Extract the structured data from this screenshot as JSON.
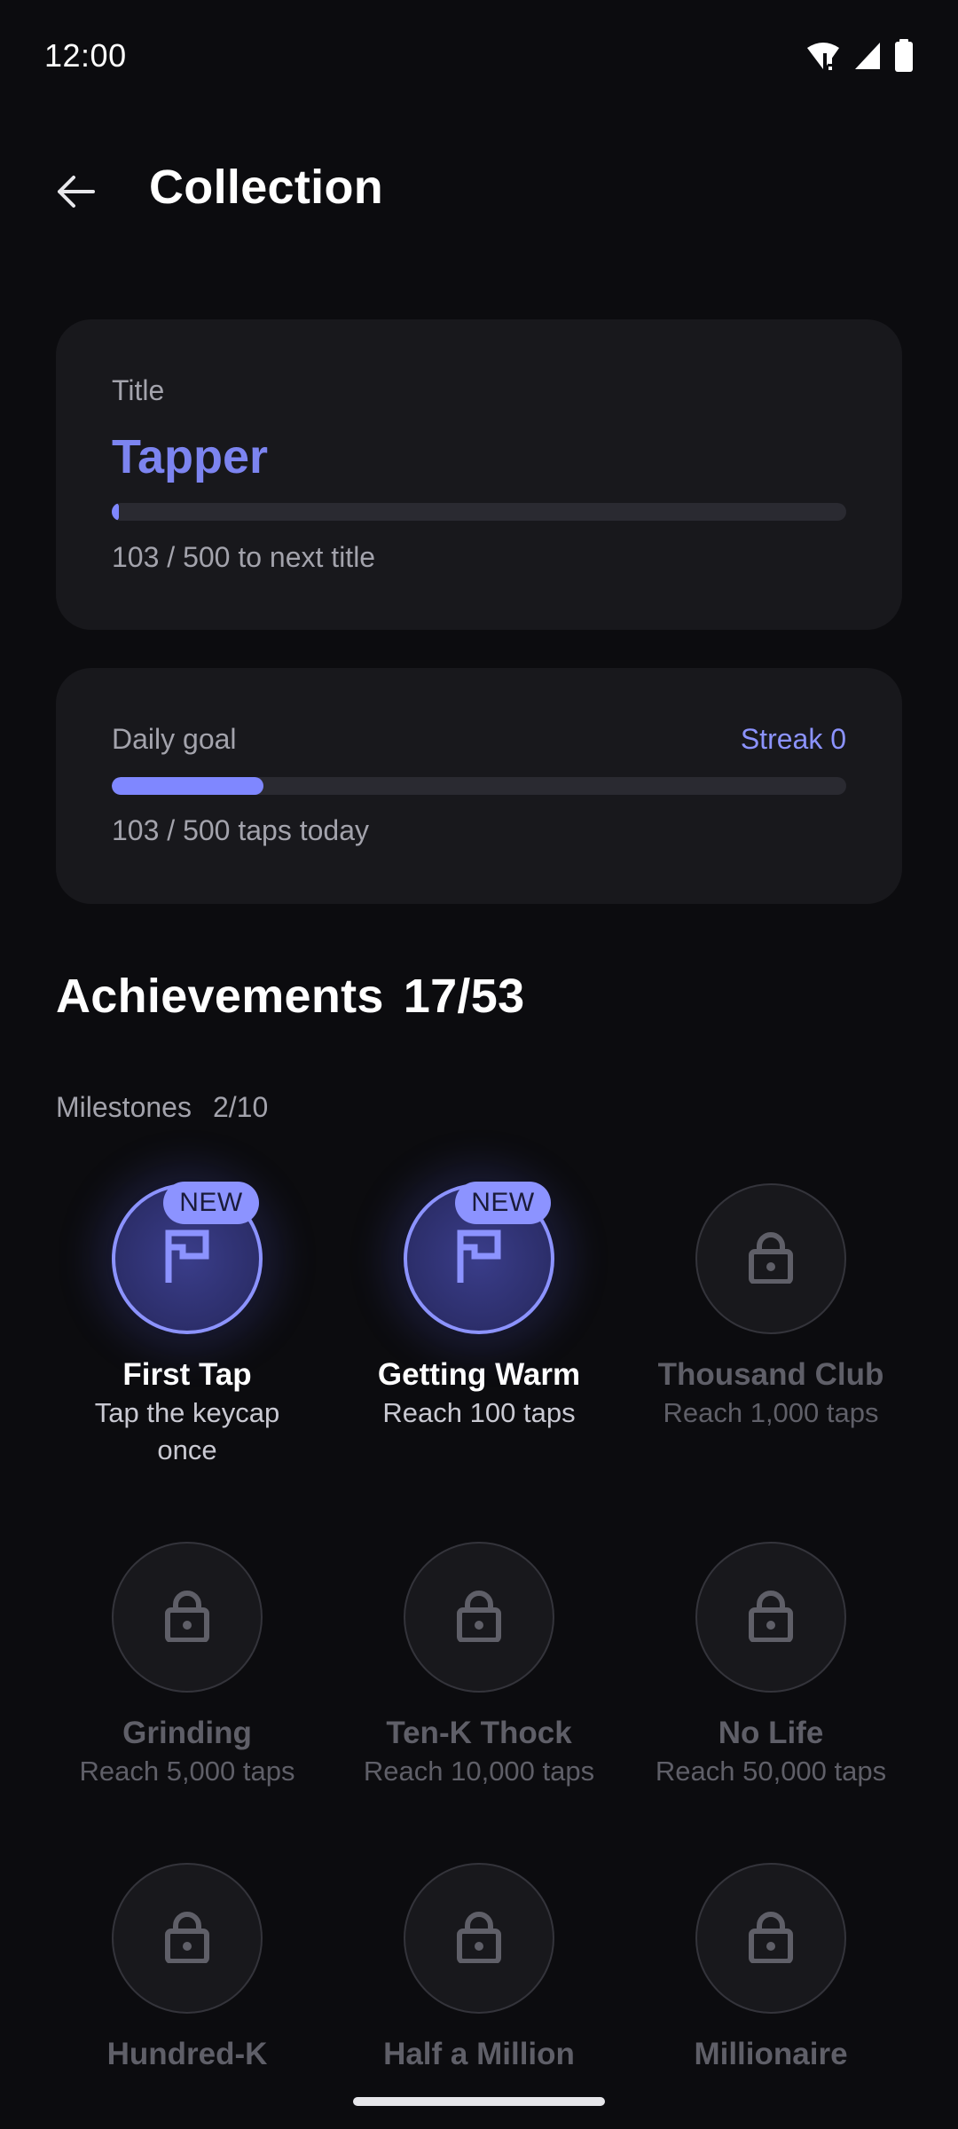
{
  "status_bar": {
    "time": "12:00",
    "icons": [
      "wifi-alert-icon",
      "signal-icon",
      "battery-icon"
    ]
  },
  "app_bar": {
    "title": "Collection",
    "back_icon": "arrow-left-icon"
  },
  "title_card": {
    "label": "Title",
    "value": "Tapper",
    "progress_current": 103,
    "progress_target": 500,
    "progress_text": "103 / 500 to next title",
    "progress_fill": 0.008
  },
  "daily_card": {
    "label": "Daily goal",
    "streak": "Streak 0",
    "progress_current": 103,
    "progress_target": 500,
    "progress_text": "103 / 500 taps today",
    "progress_fill": 0.206
  },
  "achievements": {
    "title": "Achievements",
    "count": "17/53",
    "milestones": {
      "label": "Milestones",
      "count": "2/10",
      "items": [
        {
          "name": "First Tap",
          "desc": "Tap the keycap once",
          "unlocked": true,
          "badge": "NEW",
          "icon": "flag-icon"
        },
        {
          "name": "Getting Warm",
          "desc": "Reach 100 taps",
          "unlocked": true,
          "badge": "NEW",
          "icon": "flag-icon"
        },
        {
          "name": "Thousand Club",
          "desc": "Reach 1,000 taps",
          "unlocked": false,
          "icon": "lock-icon"
        },
        {
          "name": "Grinding",
          "desc": "Reach 5,000 taps",
          "unlocked": false,
          "icon": "lock-icon"
        },
        {
          "name": "Ten-K Thock",
          "desc": "Reach 10,000 taps",
          "unlocked": false,
          "icon": "lock-icon"
        },
        {
          "name": "No Life",
          "desc": "Reach 50,000 taps",
          "unlocked": false,
          "icon": "lock-icon"
        },
        {
          "name": "Hundred-K",
          "desc": "",
          "unlocked": false,
          "icon": "lock-icon"
        },
        {
          "name": "Half a Million",
          "desc": "",
          "unlocked": false,
          "icon": "lock-icon"
        },
        {
          "name": "Millionaire",
          "desc": "",
          "unlocked": false,
          "icon": "lock-icon"
        }
      ]
    }
  },
  "colors": {
    "background": "#0c0c0f",
    "card": "#18181c",
    "accent": "#7f87ff",
    "accent_text": "#8c93ff",
    "muted_text": "#a3a3ac",
    "locked_text": "#5f5f68"
  }
}
